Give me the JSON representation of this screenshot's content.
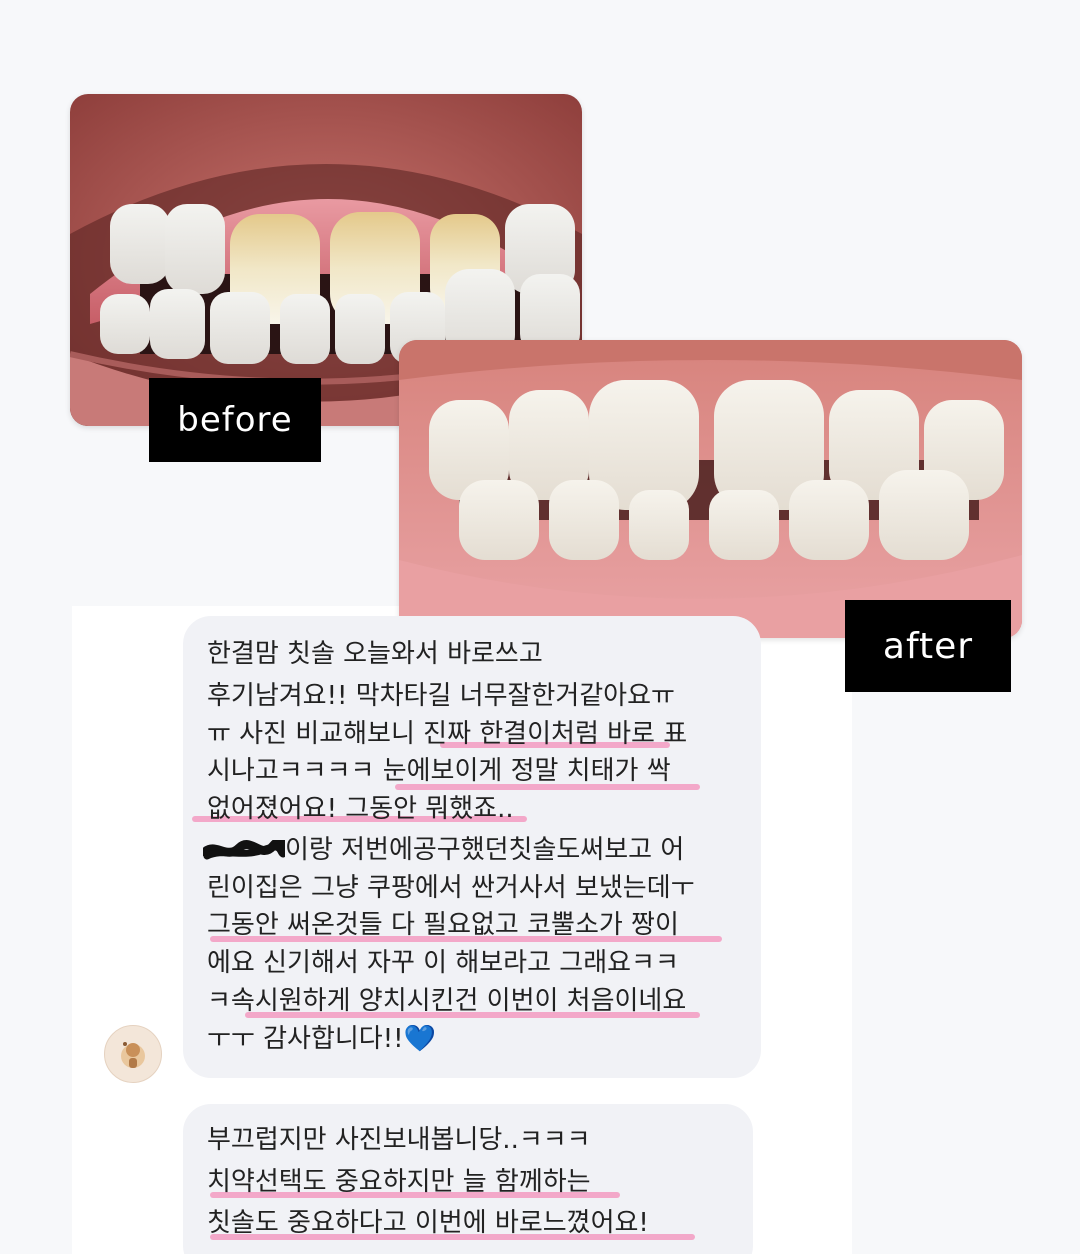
{
  "photos": {
    "before_label": "before",
    "after_label": "after"
  },
  "chat": {
    "message1": {
      "lines": [
        "한결맘 칫솔 오늘와서 바로쓰고",
        "후기남겨요!!  막차타길 너무잘한거같아요ㅠ",
        "ㅠ 사진 비교해보니 진짜 한결이처럼 바로 표",
        "시나고ㅋㅋㅋㅋ 눈에보이게 정말 치태가 싹",
        "없어졌어요! 그동안 뭐했죠..",
        "이랑 저번에공구했던칫솔도써보고 어",
        "린이집은 그냥 쿠팡에서 싼거사서 보냈는데ㅜ",
        "그동안 써온것들 다 필요없고 코뿔소가 짱이",
        "에요 신기해서 자꾸 이 해보라고 그래요ㅋㅋ",
        "ㅋ속시원하게 양치시킨건 이번이 처음이네요",
        "ㅜㅜ 감사합니다!!💙"
      ]
    },
    "message2": {
      "lines": [
        "부끄럽지만 사진보내봅니당..ㅋㅋㅋ",
        "치약선택도 중요하지만 늘 함께하는",
        "칫솔도 중요하다고 이번에 바로느꼈어요!"
      ]
    }
  },
  "colors": {
    "highlight": "#f2a3c6",
    "bubble": "#f1f2f6",
    "heart": "#1e7be6"
  }
}
